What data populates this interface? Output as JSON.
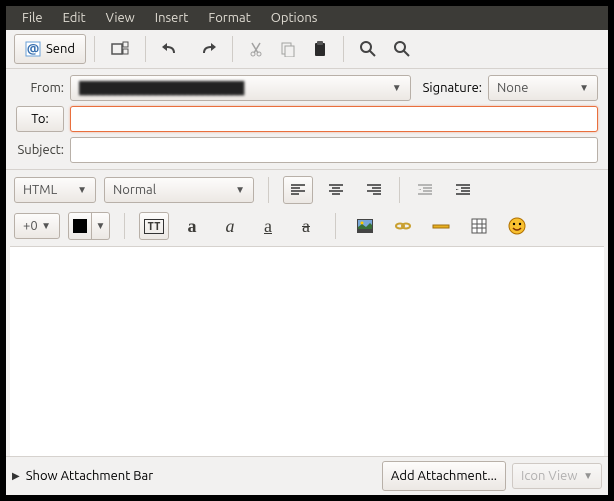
{
  "menu": {
    "file": "File",
    "edit": "Edit",
    "view": "View",
    "insert": "Insert",
    "format": "Format",
    "options": "Options"
  },
  "toolbar": {
    "send": "Send"
  },
  "fields": {
    "from_label": "From:",
    "from_value": "████████████████████████████",
    "signature_label": "Signature:",
    "signature_value": "None",
    "to_label": "To:",
    "to_value": "",
    "subject_label": "Subject:",
    "subject_value": ""
  },
  "format": {
    "mode": "HTML",
    "style": "Normal",
    "size": "+0"
  },
  "status": {
    "show_attachment": "Show Attachment Bar",
    "add_attachment": "Add Attachment...",
    "icon_view": "Icon View"
  }
}
